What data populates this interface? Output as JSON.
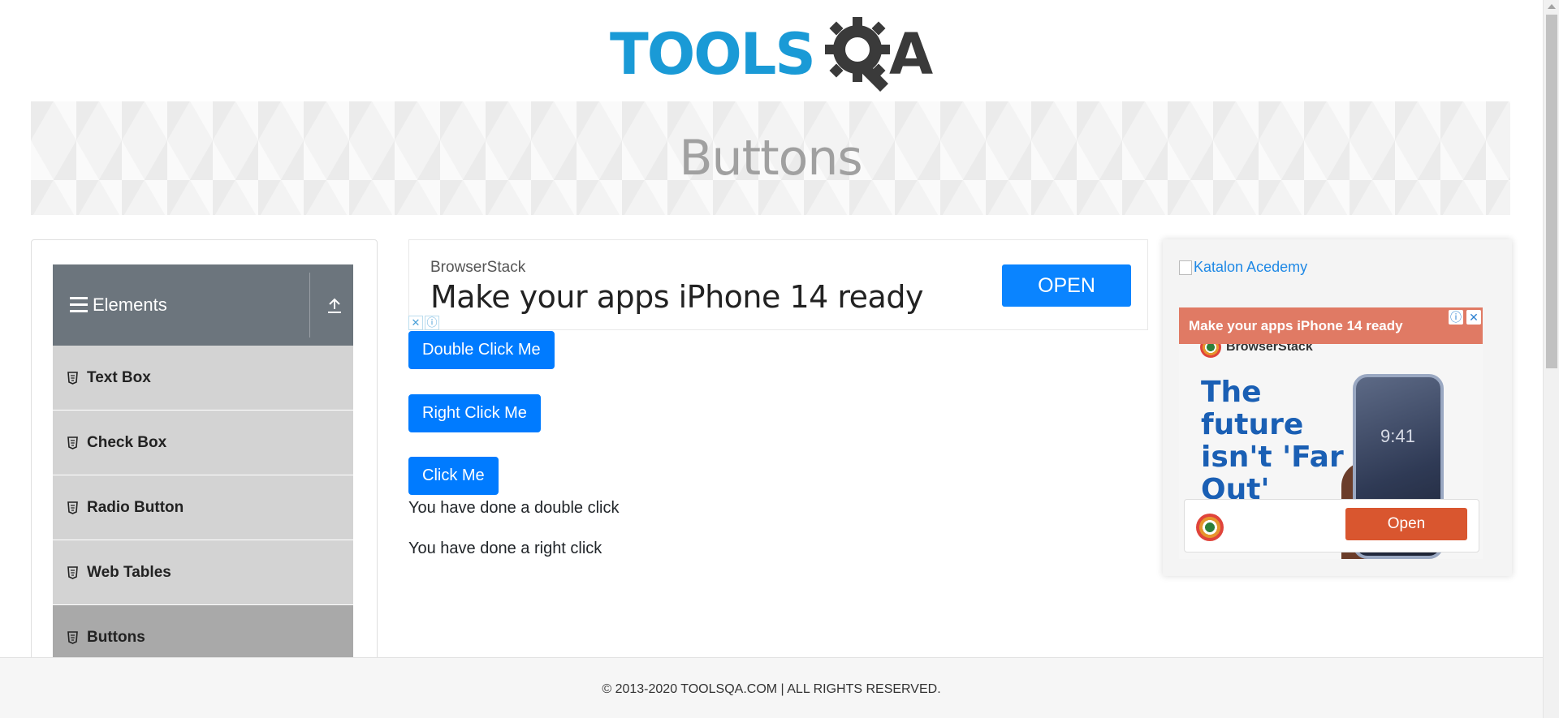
{
  "header": {
    "logo_text": "TOOLS",
    "logo_text_tail": "A",
    "logo_colors": {
      "tools": "#1a9ad6",
      "qa": "#3a3a3a"
    }
  },
  "banner": {
    "title": "Buttons"
  },
  "sidebar": {
    "group_title": "Elements",
    "items": [
      {
        "label": "Text Box",
        "icon": "html5-icon"
      },
      {
        "label": "Check Box",
        "icon": "html5-icon"
      },
      {
        "label": "Radio Button",
        "icon": "html5-icon"
      },
      {
        "label": "Web Tables",
        "icon": "html5-icon"
      },
      {
        "label": "Buttons",
        "icon": "html5-icon",
        "active": true
      }
    ]
  },
  "top_ad": {
    "brand": "BrowserStack",
    "headline": "Make your apps iPhone 14 ready",
    "button": "OPEN"
  },
  "main": {
    "double_click_button": "Double Click Me",
    "right_click_button": "Right Click Me",
    "click_button": "Click Me",
    "double_click_message": "You have done a double click",
    "right_click_message": "You have done a right click"
  },
  "right_ad": {
    "broken_image_alt": "Katalon Acedemy",
    "bar_text": "Make your apps iPhone 14 ready",
    "brand": "BrowserStack",
    "tagline": "The future isn't 'Far Out'",
    "phone_time": "9:41",
    "cta_button": "Open",
    "accent_color": "#d9562f"
  },
  "footer": {
    "text": "© 2013-2020 TOOLSQA.COM | ALL RIGHTS RESERVED."
  }
}
